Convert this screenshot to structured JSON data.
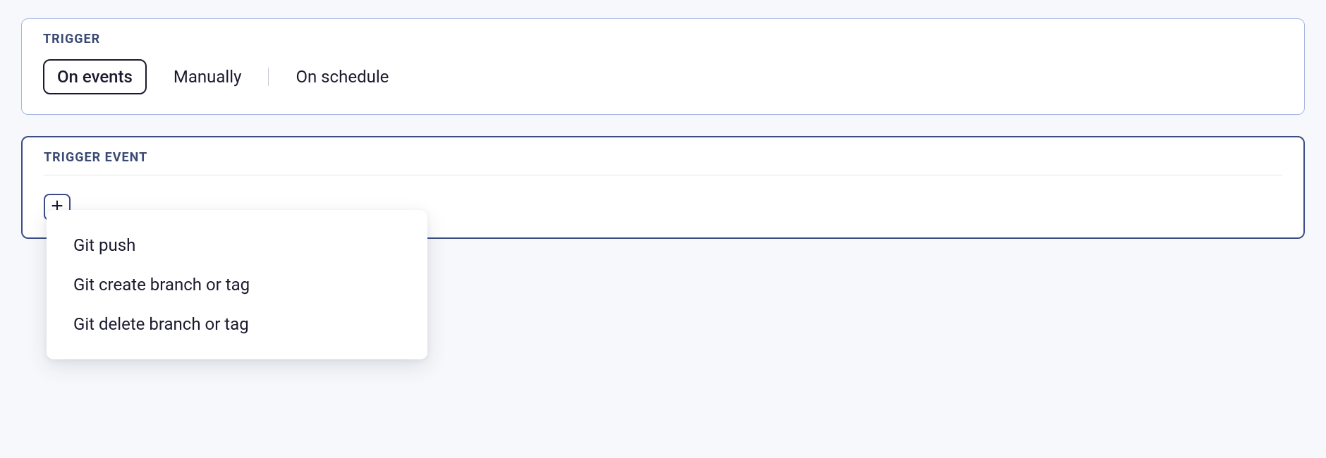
{
  "trigger": {
    "label": "Trigger",
    "options": {
      "on_events": "On events",
      "manually": "Manually",
      "on_schedule": "On schedule"
    }
  },
  "trigger_event": {
    "label": "Trigger Event",
    "dropdown": {
      "git_push": "Git push",
      "git_create": "Git create branch or tag",
      "git_delete": "Git delete branch or tag"
    }
  }
}
